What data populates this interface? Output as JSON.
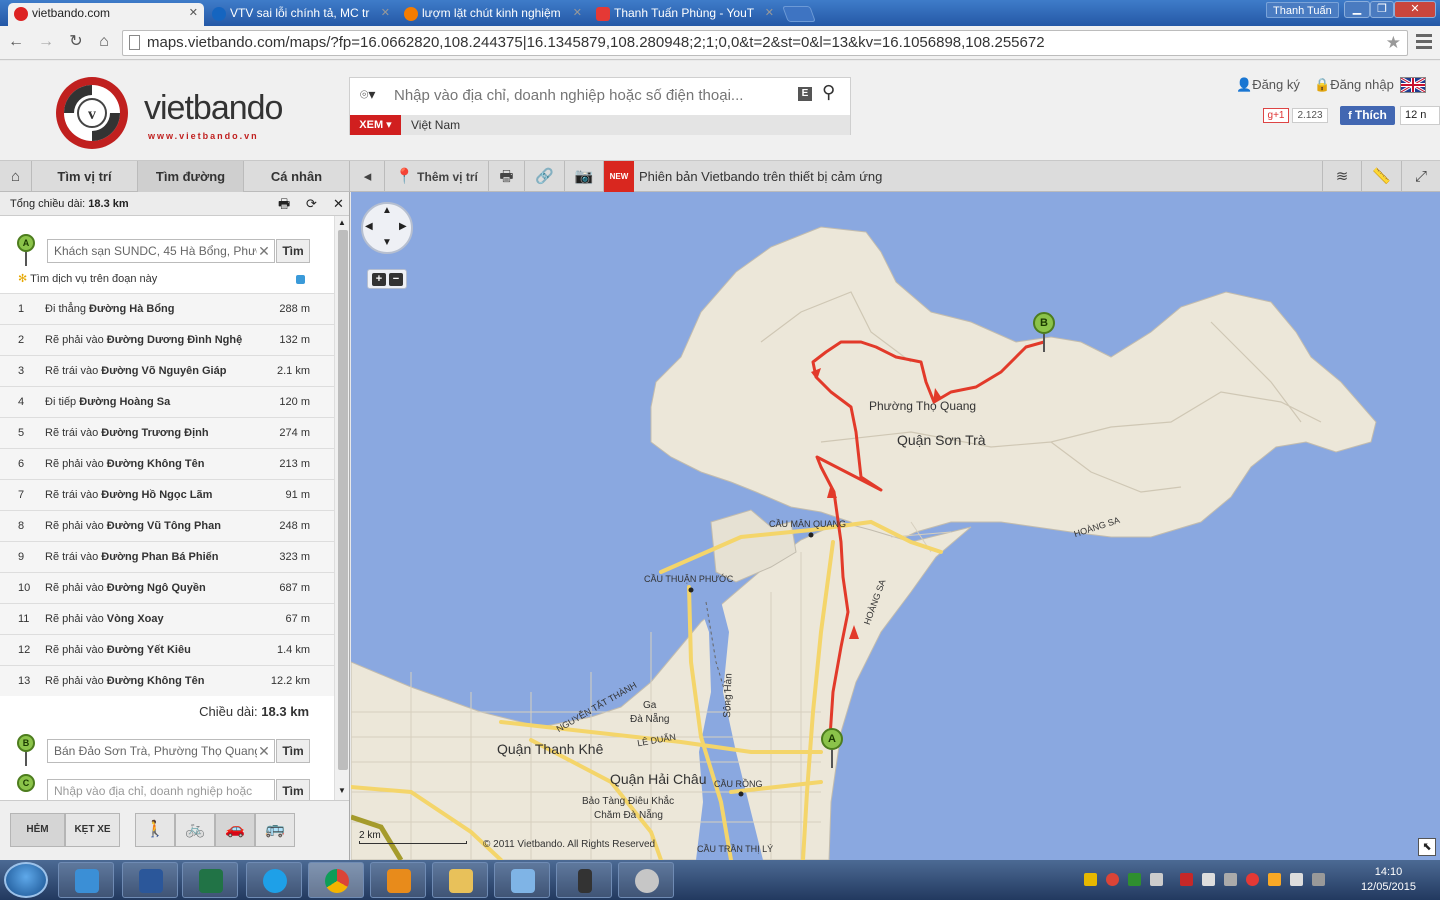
{
  "browser": {
    "tabs": [
      {
        "title": "vietbando.com",
        "icon_color": "#d22",
        "active": true
      },
      {
        "title": "VTV sai lỗi chính tả, MC tr",
        "icon_color": "#1565c0"
      },
      {
        "title": "lượm lặt chút kinh nghiệm",
        "icon_color": "#f57c00"
      },
      {
        "title": "Thanh Tuấn Phùng - YouT",
        "icon_color": "#e53935"
      }
    ],
    "user_name": "Thanh Tuấn",
    "url": "maps.vietbando.com/maps/?fp=16.0662820,108.244375|16.1345879,108.280948;2;1;0,0&t=2&st=0&l=13&kv=16.1056898,108.255672"
  },
  "header": {
    "logo_text": "vietbando",
    "logo_sub": "www.vietbando.vn",
    "search_placeholder": "Nhập vào địa chỉ, doanh nghiệp hoặc số điện thoại...",
    "search_button_label": "XEM",
    "country": "Việt Nam",
    "register": "Đăng ký",
    "login": "Đăng nhập",
    "gplus": "g+1",
    "gplus_count": "2.123",
    "fb_like": "Thích",
    "fb_count": "12 n",
    "keyboard_label": "E"
  },
  "nav": {
    "tabs": [
      "Tìm vị trí",
      "Tìm đường",
      "Cá nhân"
    ],
    "add_location": "Thêm vị trí",
    "new_badge": "NEW",
    "news": "Phiên bản Vietbando trên thiết bị cảm ứng"
  },
  "panel": {
    "total_label": "Tổng chiều dài:",
    "total_value": "18.3 km",
    "point_a_label": "A",
    "point_a": "Khách sạn SUNDC, 45 Hà Bổng, Phườ",
    "point_b_label": "B",
    "point_b": "Bán Đảo Sơn Trà, Phường Thọ Quang",
    "point_c_label": "C",
    "point_c_placeholder": "Nhập vào địa chỉ, doanh nghiệp hoặc",
    "find_label": "Tìm",
    "services_link": "Tìm dịch vụ trên đoạn này",
    "steps": [
      {
        "n": "1",
        "action": "Đi thẳng",
        "road": "Đường Hà Bổng",
        "dist": "288 m"
      },
      {
        "n": "2",
        "action": "Rẽ phải vào",
        "road": "Đường Dương Đình Nghệ",
        "dist": "132 m"
      },
      {
        "n": "3",
        "action": "Rẽ trái vào",
        "road": "Đường Võ Nguyên Giáp",
        "dist": "2.1 km"
      },
      {
        "n": "4",
        "action": "Đi tiếp",
        "road": "Đường Hoàng Sa",
        "dist": "120 m"
      },
      {
        "n": "5",
        "action": "Rẽ trái vào",
        "road": "Đường Trương Định",
        "dist": "274 m"
      },
      {
        "n": "6",
        "action": "Rẽ phải vào",
        "road": "Đường Không Tên",
        "dist": "213 m"
      },
      {
        "n": "7",
        "action": "Rẽ trái vào",
        "road": "Đường Hồ Ngọc Lãm",
        "dist": "91 m"
      },
      {
        "n": "8",
        "action": "Rẽ phải vào",
        "road": "Đường Vũ Tông Phan",
        "dist": "248 m"
      },
      {
        "n": "9",
        "action": "Rẽ trái vào",
        "road": "Đường Phan Bá Phiến",
        "dist": "323 m"
      },
      {
        "n": "10",
        "action": "Rẽ phải vào",
        "road": "Đường Ngô Quyền",
        "dist": "687 m"
      },
      {
        "n": "11",
        "action": "Rẽ phải vào",
        "road": "Vòng Xoay",
        "dist": "67 m"
      },
      {
        "n": "12",
        "action": "Rẽ phải vào",
        "road": "Đường Yết Kiêu",
        "dist": "1.4 km"
      },
      {
        "n": "13",
        "action": "Rẽ phải vào",
        "road": "Đường Không Tên",
        "dist": "12.2 km"
      }
    ],
    "length_label": "Chiều dài:",
    "length_value": "18.3 km",
    "mode_hem": "HẺM",
    "mode_ketxe": "KẸT XE"
  },
  "map": {
    "labels": {
      "tho_quang": "Phường Thọ Quang",
      "son_tra": "Quận Sơn Trà",
      "thanh_khe": "Quận Thanh Khê",
      "hai_chau": "Quận Hải Châu",
      "cau_man_quang": "CẦU MÂN QUANG",
      "cau_thuan_phuoc": "CẦU THUẬN PHƯỚC",
      "hoang_sa_1": "HOÀNG SA",
      "hoang_sa_2": "HOÀNG SA",
      "song_han": "Sông Hàn",
      "ga_danang_1": "Ga",
      "ga_danang_2": "Đà Nẵng",
      "le_duan": "LÊ DUẨN",
      "nguyen_tat_thanh": "NGUYỄN TẤT THÀNH",
      "cau_rong": "CẦU RỒNG",
      "bao_tang_1": "Bảo Tàng Điêu Khắc",
      "bao_tang_2": "Chăm Đà Nẵng",
      "cau_tran_thi_ly": "CẦU TRẦN THỊ LÝ"
    },
    "marker_a": "A",
    "marker_b": "B",
    "scale": "2 km",
    "copyright": "© 2011 Vietbando. All Rights Reserved"
  },
  "taskbar": {
    "time": "14:10",
    "date": "12/05/2015"
  }
}
